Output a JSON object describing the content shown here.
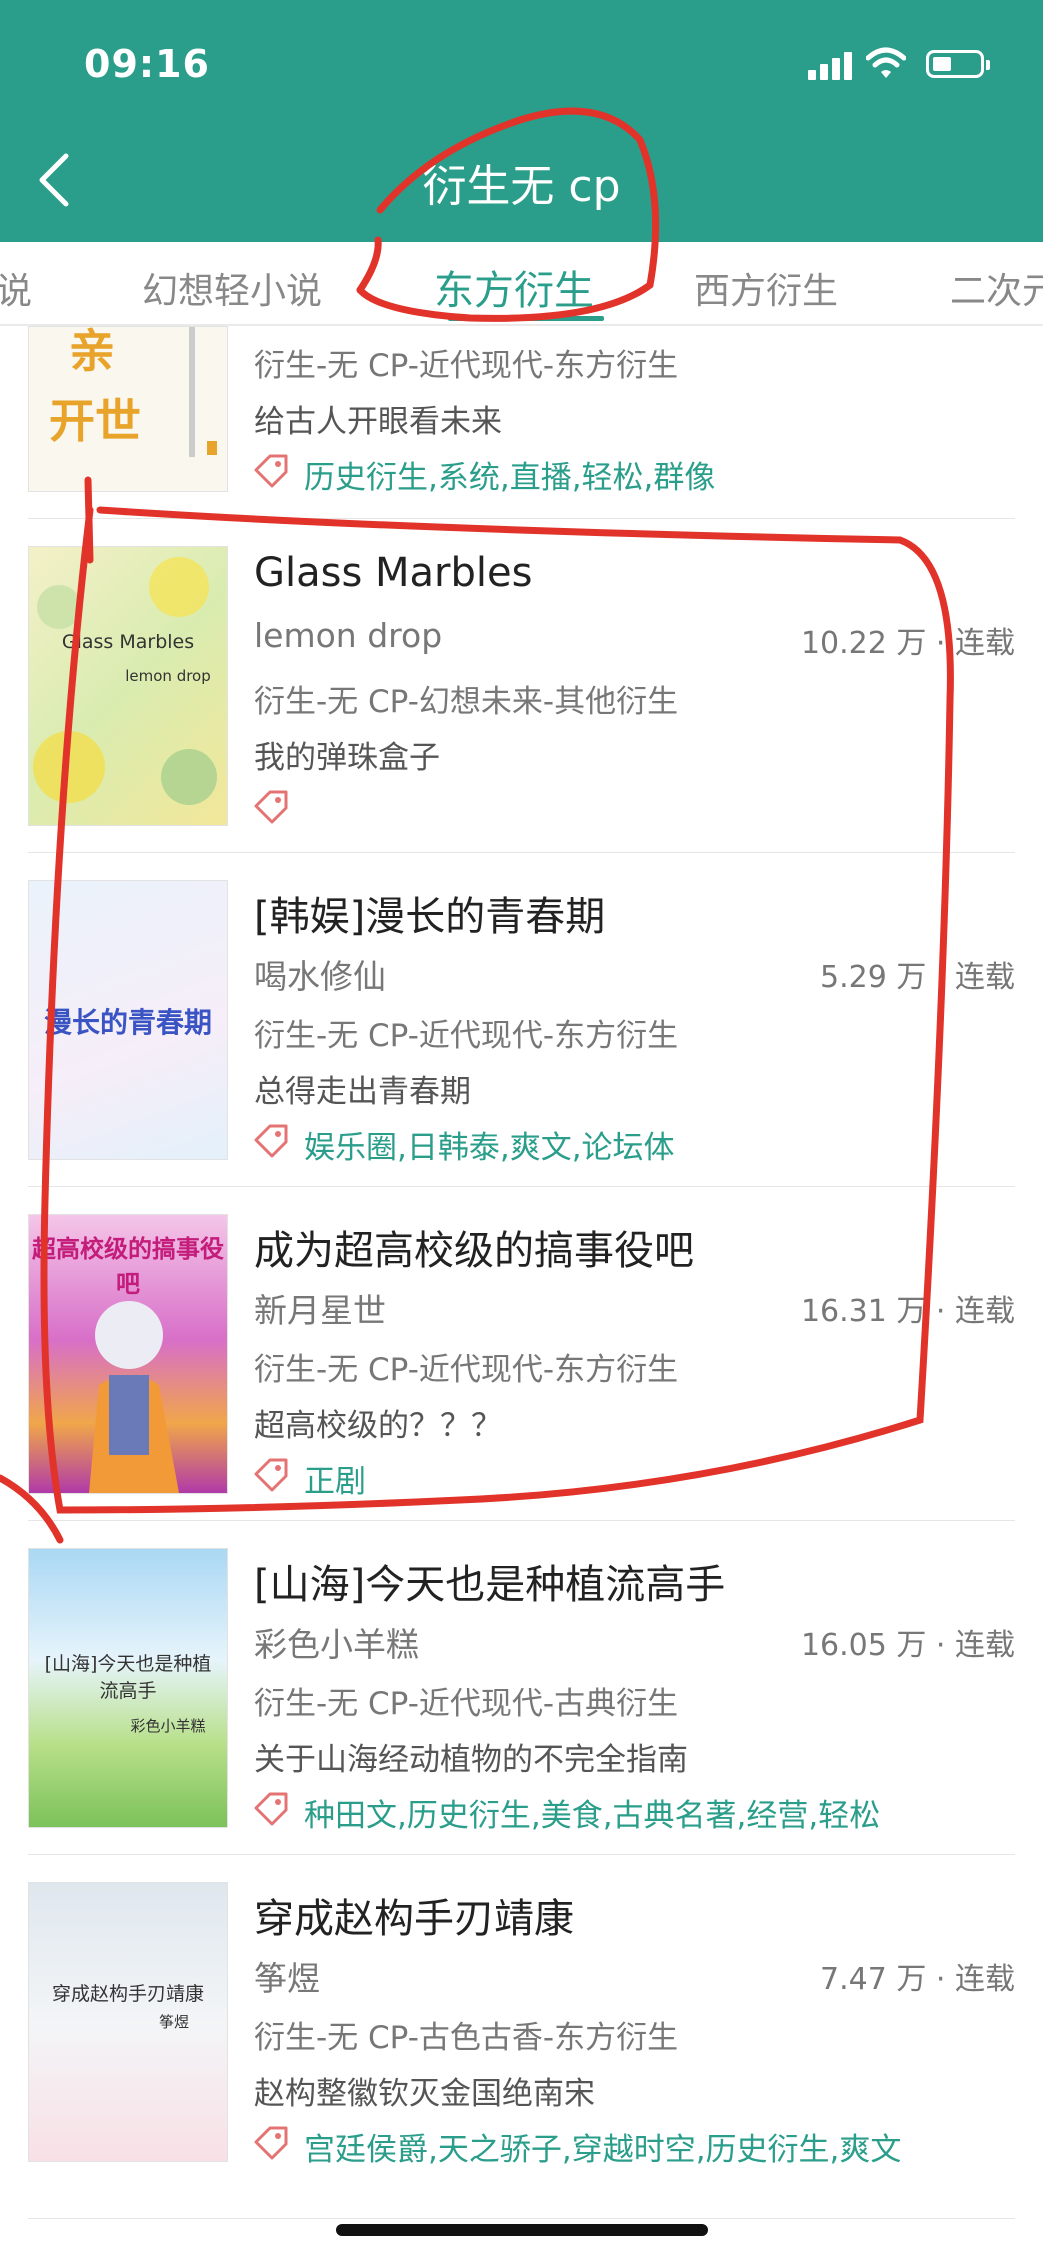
{
  "status_bar": {
    "time": "09:16"
  },
  "header": {
    "title": "衍生无 cp"
  },
  "tabs": [
    {
      "label": "小说"
    },
    {
      "label": "幻想轻小说"
    },
    {
      "label": "东方衍生"
    },
    {
      "label": "西方衍生"
    },
    {
      "label": "二次元"
    }
  ],
  "books": [
    {
      "title": "",
      "author": "",
      "count": "",
      "category": "衍生-无 CP-近代现代-东方衍生",
      "summary": "给古人开眼看未来",
      "tags": "历史衍生,系统,直播,轻松,群像"
    },
    {
      "title": "Glass Marbles",
      "author": "lemon drop",
      "count": "10.22 万 · 连载",
      "category": "衍生-无 CP-幻想未来-其他衍生",
      "summary": "我的弹珠盒子",
      "tags": "",
      "cover_title": "Glass Marbles",
      "cover_author": "lemon drop"
    },
    {
      "title": "[韩娱]漫长的青春期",
      "author": "喝水修仙",
      "count": "5.29 万 · 连载",
      "category": "衍生-无 CP-近代现代-东方衍生",
      "summary": "总得走出青春期",
      "tags": "娱乐圈,日韩泰,爽文,论坛体",
      "cover_title": "漫长的青春期"
    },
    {
      "title": "成为超高校级的搞事役吧",
      "author": "新月星世",
      "count": "16.31 万 · 连载",
      "category": "衍生-无 CP-近代现代-东方衍生",
      "summary": "超高校级的？？？",
      "tags": "正剧",
      "cover_title": "超高校级的搞事役吧"
    },
    {
      "title": "[山海]今天也是种植流高手",
      "author": "彩色小羊糕",
      "count": "16.05 万 · 连载",
      "category": "衍生-无 CP-近代现代-古典衍生",
      "summary": "关于山海经动植物的不完全指南",
      "tags": "种田文,历史衍生,美食,古典名著,经营,轻松",
      "cover_title": "[山海]今天也是种植流高手",
      "cover_author": "彩色小羊糕"
    },
    {
      "title": "穿成赵构手刃靖康",
      "author": "筝煜",
      "count": "7.47 万 · 连载",
      "category": "衍生-无 CP-古色古香-东方衍生",
      "summary": "赵构整徽钦灭金国绝南宋",
      "tags": "宫廷侯爵,天之骄子,穿越时空,历史衍生,爽文",
      "cover_title": "穿成赵构手刃靖康",
      "cover_author": "筝煜"
    }
  ],
  "colors": {
    "header": "#2a9e8a",
    "accent": "#2a9e8a",
    "annotation": "#e2332a"
  },
  "icons": [
    "back-arrow-icon",
    "signal-icon",
    "wifi-icon",
    "battery-icon",
    "tag-icon"
  ]
}
